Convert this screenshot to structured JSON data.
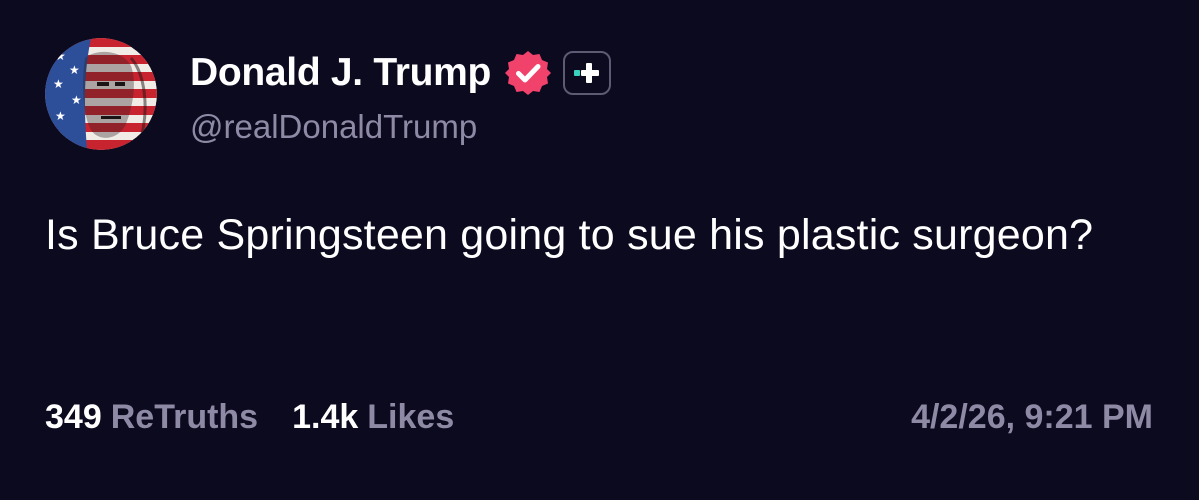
{
  "post": {
    "author": {
      "display_name": "Donald J. Trump",
      "handle": "@realDonaldTrump",
      "verified_icon": "verified-badge-icon",
      "subscription_icon": "plus-badge-icon",
      "avatar_icon": "avatar-flag-portrait"
    },
    "text": "Is Bruce Springsteen going to sue his plastic surgeon?",
    "stats": {
      "retruths_count": "349",
      "retruths_label": "ReTruths",
      "likes_count": "1.4k",
      "likes_label": "Likes"
    },
    "timestamp": "4/2/26, 9:21 PM"
  },
  "colors": {
    "background": "#0c0a1f",
    "primary_text": "#ffffff",
    "secondary_text": "#8e8aa6",
    "verified_badge": "#f0426b",
    "plus_accent": "#39d3c0"
  }
}
